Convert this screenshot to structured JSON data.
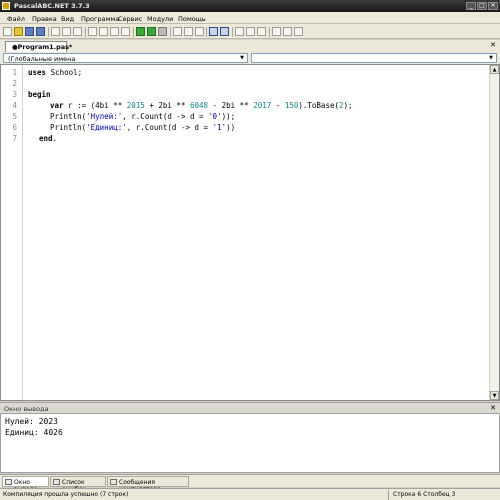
{
  "window": {
    "title": "PascalABC.NET 3.7.3",
    "controls": [
      "_",
      "□",
      "✕"
    ]
  },
  "menu": [
    "Файл",
    "Правка",
    "Вид",
    "Программа",
    "Сервис",
    "Модули",
    "Помощь"
  ],
  "tab": {
    "label": "●Program1.pas*",
    "close": "✕"
  },
  "combos": {
    "left": "(Глобальные имена",
    "right": ""
  },
  "editor": {
    "line_numbers": [
      "1",
      "2",
      "3",
      "4",
      "5",
      "6",
      "7"
    ],
    "lines": {
      "l1_kw": "uses",
      "l1_rest": " School;",
      "l3_kw": "begin",
      "l4_kw": "var",
      "l4_a": " r := (4bi ** ",
      "l4_n1": "2015",
      "l4_b": " + 2bi ** ",
      "l4_n2": "6048",
      "l4_c": " - 2bi ** ",
      "l4_n3": "2017",
      "l4_d": " - ",
      "l4_n4": "150",
      "l4_e": ").ToBase(",
      "l4_n5": "2",
      "l4_f": ");",
      "l5_a": "Println(",
      "l5_s1": "'Нулей:'",
      "l5_b": ", r.Count(d -> d = ",
      "l5_s2": "'0'",
      "l5_c": "));",
      "l6_a": "Println(",
      "l6_s1": "'Единиц:'",
      "l6_b": ", r.Count(d -> d = ",
      "l6_s2": "'1'",
      "l6_c": "))",
      "l7_kw": "end",
      "l7_rest": "."
    }
  },
  "output": {
    "header": "Окно вывода",
    "close": "✕",
    "lines": [
      "Нулей: 2023",
      "Единиц: 4026"
    ]
  },
  "bottom_tabs": [
    "Окно вывода",
    "Список ошибок",
    "Сообщения компилятора"
  ],
  "status": {
    "message": "Компиляция прошла успешно (7 строк)",
    "position": "Строка  6  Столбец  3"
  }
}
